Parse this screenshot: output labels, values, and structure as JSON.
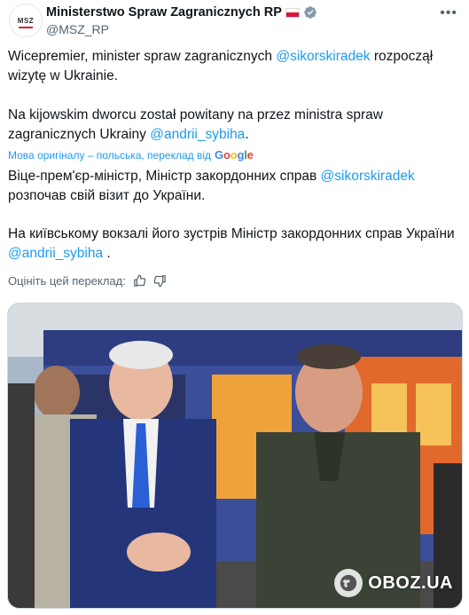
{
  "author": {
    "display_name": "Ministerstwo Spraw Zagranicznych RP",
    "handle": "@MSZ_RP",
    "avatar_text": "MSZ"
  },
  "post": {
    "original": {
      "p1_text": "Wicepremier, minister spraw zagranicznych ",
      "p1_mention": "@sikorskiradek",
      "p1_text_after": " rozpoczął wizytę w Ukrainie.",
      "p2_text": "Na kijowskim dworcu został powitany na przez ministra spraw zagranicznych Ukrainy ",
      "p2_mention": "@andrii_sybiha",
      "p2_text_after": "."
    },
    "translation_note": "Мова оригіналу – польська, переклад від",
    "translation_provider": "Google",
    "translated": {
      "p1_text": "Віце-прем'єр-міністр, Міністр закордонних справ ",
      "p1_mention": "@sikorskiradek",
      "p1_text_after": " розпочав свій візит до України.",
      "p2_text": "На київському вокзалі його зустрів Міністр закордонних справ України ",
      "p2_mention": "@andrii_sybiha",
      "p2_text_after": " ."
    },
    "rate_translation_label": "Оцініть цей переклад:"
  },
  "media": {
    "watermark": "OBOZ.UA"
  },
  "icons": {
    "verified": "verified-badge-icon",
    "more": "more-options-icon",
    "thumb_up": "thumb-up-icon",
    "thumb_down": "thumb-down-icon"
  },
  "colors": {
    "link": "#1d9bf0",
    "secondary_text": "#536471",
    "flag_red": "#dc143c"
  }
}
